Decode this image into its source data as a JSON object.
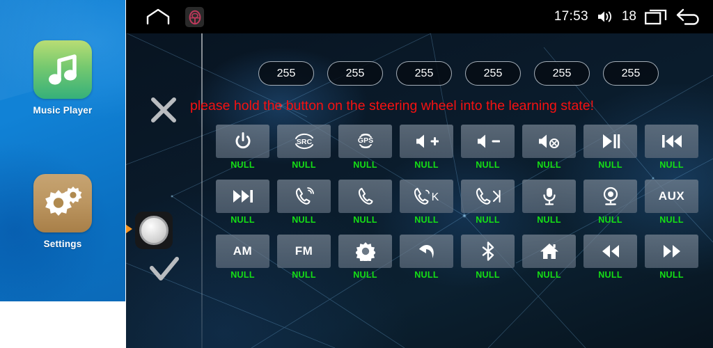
{
  "launcher": {
    "apps": [
      {
        "label": "Music Player",
        "icon": "music-note-icon"
      },
      {
        "label": "Settings",
        "icon": "gears-icon"
      }
    ]
  },
  "statusbar": {
    "home_icon": "home-icon",
    "steering_wheel_icon": "steering-wheel-icon",
    "time": "17:53",
    "volume_icon": "volume-icon",
    "volume_level": "18",
    "recents_icon": "recents-icon",
    "back_icon": "back-arrow-icon"
  },
  "controls": {
    "cancel_icon": "close-x-icon",
    "confirm_icon": "check-icon",
    "pointer_icon": "orange-arrow-icon",
    "knob_icon": "rotary-knob-icon"
  },
  "pills": [
    {
      "value": "255"
    },
    {
      "value": "255"
    },
    {
      "value": "255"
    },
    {
      "value": "255"
    },
    {
      "value": "255"
    },
    {
      "value": "255"
    }
  ],
  "message": {
    "text": "please hold the button on the steering wheel into the learning state!",
    "color": "#f61111"
  },
  "grid": {
    "label_color": "#15e015",
    "rows": [
      [
        {
          "icon": "power-icon",
          "label": "NULL"
        },
        {
          "icon": "src-icon",
          "label": "NULL"
        },
        {
          "icon": "gps-icon",
          "label": "NULL"
        },
        {
          "icon": "volume-up-icon",
          "label": "NULL"
        },
        {
          "icon": "volume-down-icon",
          "label": "NULL"
        },
        {
          "icon": "mute-icon",
          "label": "NULL"
        },
        {
          "icon": "play-pause-icon",
          "label": "NULL"
        },
        {
          "icon": "previous-track-icon",
          "label": "NULL"
        }
      ],
      [
        {
          "icon": "next-track-icon",
          "label": "NULL"
        },
        {
          "icon": "phone-answer-icon",
          "label": "NULL"
        },
        {
          "icon": "phone-hangup-icon",
          "label": "NULL"
        },
        {
          "icon": "phone-answer-k-icon",
          "label": "NULL"
        },
        {
          "icon": "phone-hangup-skip-icon",
          "label": "NULL"
        },
        {
          "icon": "microphone-icon",
          "label": "NULL"
        },
        {
          "icon": "camera-icon",
          "label": "NULL"
        },
        {
          "icon": "aux-icon",
          "label": "NULL"
        }
      ],
      [
        {
          "icon": "am-icon",
          "label": "NULL"
        },
        {
          "icon": "fm-icon",
          "label": "NULL"
        },
        {
          "icon": "brightness-icon",
          "label": "NULL"
        },
        {
          "icon": "back-icon",
          "label": "NULL"
        },
        {
          "icon": "bluetooth-icon",
          "label": "NULL"
        },
        {
          "icon": "home-icon",
          "label": "NULL"
        },
        {
          "icon": "rewind-icon",
          "label": "NULL"
        },
        {
          "icon": "fast-forward-icon",
          "label": "NULL"
        }
      ]
    ]
  }
}
